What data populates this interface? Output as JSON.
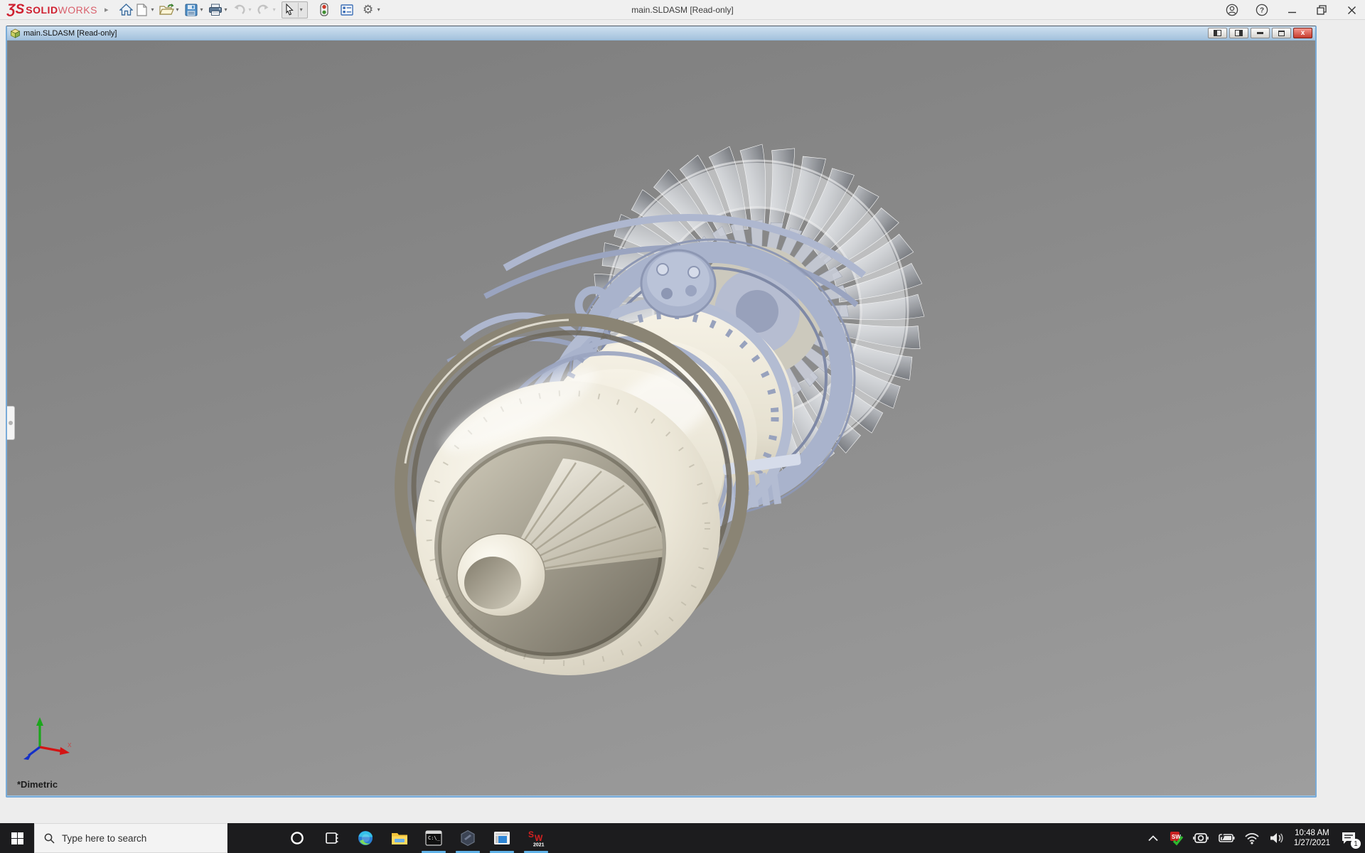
{
  "app": {
    "title": "main.SLDASM [Read-only]",
    "brand": {
      "glyph": "ƷS",
      "bold": "SOLID",
      "light": "WORKS",
      "accent_color": "#cf1f2f"
    },
    "toolbar_icons": [
      "home-icon",
      "new-document-icon",
      "open-icon",
      "save-icon",
      "print-icon",
      "undo-icon",
      "redo-icon",
      "select-cursor-icon",
      "rebuild-traffic-light-icon",
      "file-properties-icon",
      "options-gear-icon"
    ],
    "window_controls": [
      "account-icon",
      "help-icon",
      "minimize-icon",
      "restore-icon",
      "close-icon"
    ]
  },
  "doc_window": {
    "title": "main.SLDASM [Read-only]",
    "controls": [
      "split-left-icon",
      "split-right-icon",
      "minimize-icon",
      "restore-icon",
      "close-icon"
    ],
    "close_label": "x"
  },
  "viewport": {
    "view_name": "*Dimetric",
    "triad_x_label": "x",
    "background_top": "#7c7c7c",
    "background_bottom": "#9e9e9e",
    "model": "jet-engine-assembly"
  },
  "taskbar": {
    "search_placeholder": "Type here to search",
    "pinned_icons": [
      "edge-icon",
      "file-explorer-icon",
      "command-prompt-icon",
      "app-hexagon-icon",
      "app-window-icon",
      "solidworks-2021-icon"
    ],
    "running_apps": [
      "command-prompt",
      "app-hexagon",
      "app-window",
      "solidworks-2021"
    ],
    "tray_icons": [
      "hidden-icons-chevron-icon",
      "solidworks-monitor-icon",
      "screen-snip-icon",
      "battery-icon",
      "wifi-icon",
      "volume-icon",
      "notification-icon"
    ],
    "sw_badge_year": "2021",
    "clock": {
      "time": "10:48 AM",
      "date": "1/27/2021"
    },
    "notification_count": "1"
  }
}
